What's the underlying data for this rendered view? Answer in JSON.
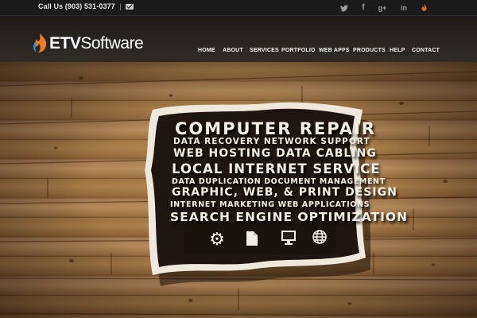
{
  "topbar": {
    "phone_label": "Call Us (903) 531-0377",
    "separator": "|",
    "mail_icon": "mail-icon",
    "social": [
      {
        "name": "twitter-icon",
        "glyph": "🐦"
      },
      {
        "name": "facebook-icon",
        "glyph": "f"
      },
      {
        "name": "google-plus-icon",
        "glyph": "g+"
      },
      {
        "name": "linkedin-icon",
        "glyph": "in"
      },
      {
        "name": "feed-icon",
        "glyph": "⚡"
      }
    ]
  },
  "header": {
    "logo_etv": "ETV",
    "logo_software": "Software",
    "logo_colors": {
      "flame_orange": "#ef7b22",
      "flame_blue": "#2f8fd8"
    }
  },
  "nav": {
    "items": [
      {
        "label": "HOME"
      },
      {
        "label": "ABOUT"
      },
      {
        "label": "SERVICES"
      },
      {
        "label": "PORTFOLIO"
      },
      {
        "label": "WEB APPS"
      },
      {
        "label": "PRODUCTS"
      },
      {
        "label": "HELP"
      },
      {
        "label": "CONTACT"
      }
    ]
  },
  "hero": {
    "sign_lines": [
      "COMPUTER REPAIR",
      "DATA RECOVERY NETWORK SUPPORT",
      "WEB HOSTING DATA CABLING",
      "LOCAL INTERNET SERVICE",
      "DATA DUPLICATION DOCUMENT MANAGEMENT",
      "GRAPHIC, WEB, & PRINT DESIGN",
      "INTERNET MARKETING WEB APPLICATIONS",
      "SEARCH ENGINE OPTIMIZATION"
    ],
    "sign_icons": [
      {
        "name": "gear-icon",
        "glyph": "⚙"
      },
      {
        "name": "document-icon",
        "glyph": "🗎"
      },
      {
        "name": "monitor-icon",
        "glyph": "🖵"
      },
      {
        "name": "globe-icon",
        "glyph": "🌐"
      }
    ]
  }
}
